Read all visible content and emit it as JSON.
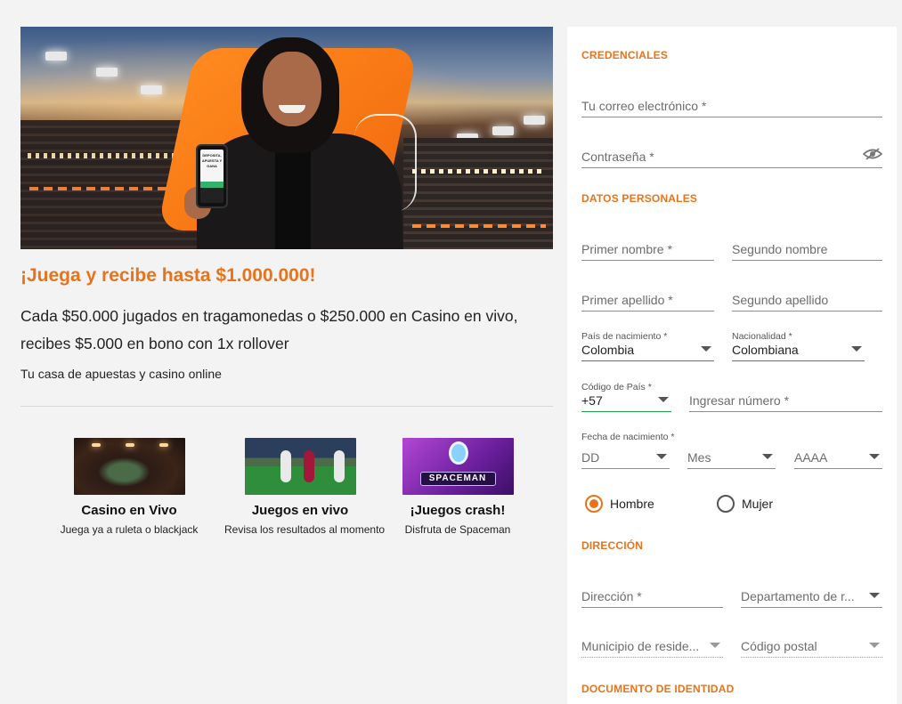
{
  "promo": {
    "title": "¡Juega y recibe hasta $1.000.000!",
    "description": "Cada $50.000 jugados en tragamonedas o $250.000 en Casino en vivo, recibes $5.000 en bono con 1x rollover",
    "tagline": "Tu casa de apuestas y casino online",
    "hero_phone_text": "DEPOSITA, APUESTA Y GANA"
  },
  "cards": [
    {
      "title": "Casino en Vivo",
      "subtitle": "Juega ya a ruleta o blackjack",
      "icon": "casino-table-image"
    },
    {
      "title": "Juegos en vivo",
      "subtitle": "Revisa los resultados al momento",
      "icon": "soccer-match-image"
    },
    {
      "title": "¡Juegos crash!",
      "subtitle": "Disfruta de Spaceman",
      "icon": "spaceman-game-image",
      "logo_text": "SPACEMAN"
    }
  ],
  "form": {
    "credentials": {
      "heading": "CREDENCIALES",
      "email_placeholder": "Tu correo electrónico *",
      "password_placeholder": "Contraseña *"
    },
    "personal": {
      "heading": "DATOS PERSONALES",
      "first_name": "Primer nombre *",
      "second_name": "Segundo nombre",
      "first_surname": "Primer apellido *",
      "second_surname": "Segundo apellido",
      "birth_country_label": "País de nacimiento *",
      "birth_country_value": "Colombia",
      "nationality_label": "Nacionalidad *",
      "nationality_value": "Colombiana",
      "country_code_label": "Código de País *",
      "country_code_value": "+57",
      "phone_placeholder": "Ingresar número *",
      "birthdate_label": "Fecha de nacimiento *",
      "day": "DD",
      "month": "Mes",
      "year": "AAAA",
      "gender_male": "Hombre",
      "gender_female": "Mujer",
      "gender_selected": "Hombre"
    },
    "address": {
      "heading": "DIRECCIÓN",
      "address_placeholder": "Dirección *",
      "department_placeholder": "Departamento de r...",
      "municipality_placeholder": "Municipio de reside...",
      "postal_placeholder": "Código postal"
    },
    "identity": {
      "heading": "DOCUMENTO DE IDENTIDAD"
    }
  },
  "colors": {
    "accent": "#e9731a",
    "valid": "#1e9c4a"
  }
}
